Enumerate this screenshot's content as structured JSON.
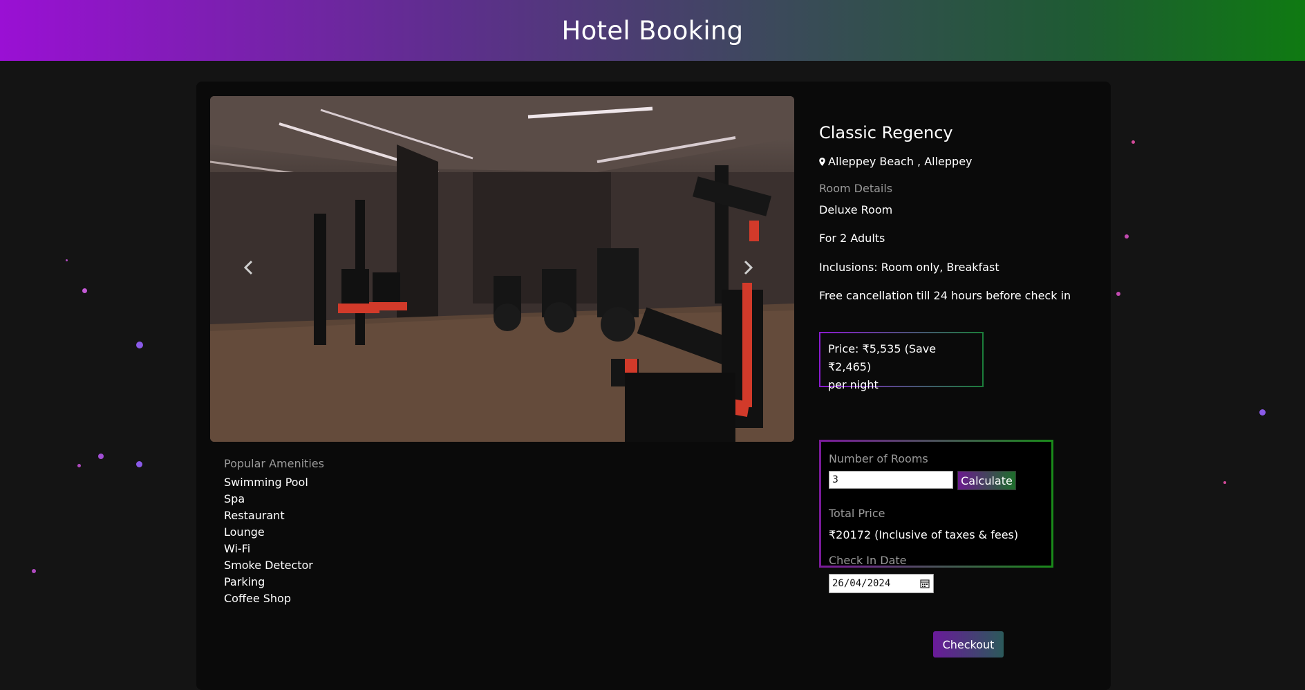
{
  "header": {
    "title": "Hotel Booking"
  },
  "hotel": {
    "name": "Classic Regency",
    "location": "Alleppey Beach , Alleppey"
  },
  "room_details": {
    "title": "Room Details",
    "room_type": "Deluxe Room",
    "occupancy": "For 2 Adults",
    "inclusions": "Inclusions: Room only, Breakfast",
    "cancellation": "Free cancellation till 24 hours before check in"
  },
  "price": {
    "line1": "Price: ₹5,535 (Save ₹2,465)",
    "line2": "per night"
  },
  "booking": {
    "rooms_label": "Number of Rooms",
    "rooms_value": "3",
    "calculate_label": "Calculate",
    "total_label": "Total Price",
    "total_value": "₹20172 (Inclusive of taxes & fees)",
    "checkin_label": "Check In Date",
    "checkin_value": "26/04/2024"
  },
  "amenities": {
    "title": "Popular Amenities",
    "items": [
      "Swimming Pool",
      "Spa",
      "Restaurant",
      "Lounge",
      "Wi-Fi",
      "Smoke Detector",
      "Parking",
      "Coffee Shop"
    ]
  },
  "carousel": {
    "prev_icon": "chevron-left-icon",
    "next_icon": "chevron-right-icon"
  },
  "checkout_label": "Checkout",
  "colors": {
    "brand_purple": "#9a10d4",
    "brand_green": "#0f7a12",
    "background": "#141414",
    "card": "#0a0a0a"
  }
}
